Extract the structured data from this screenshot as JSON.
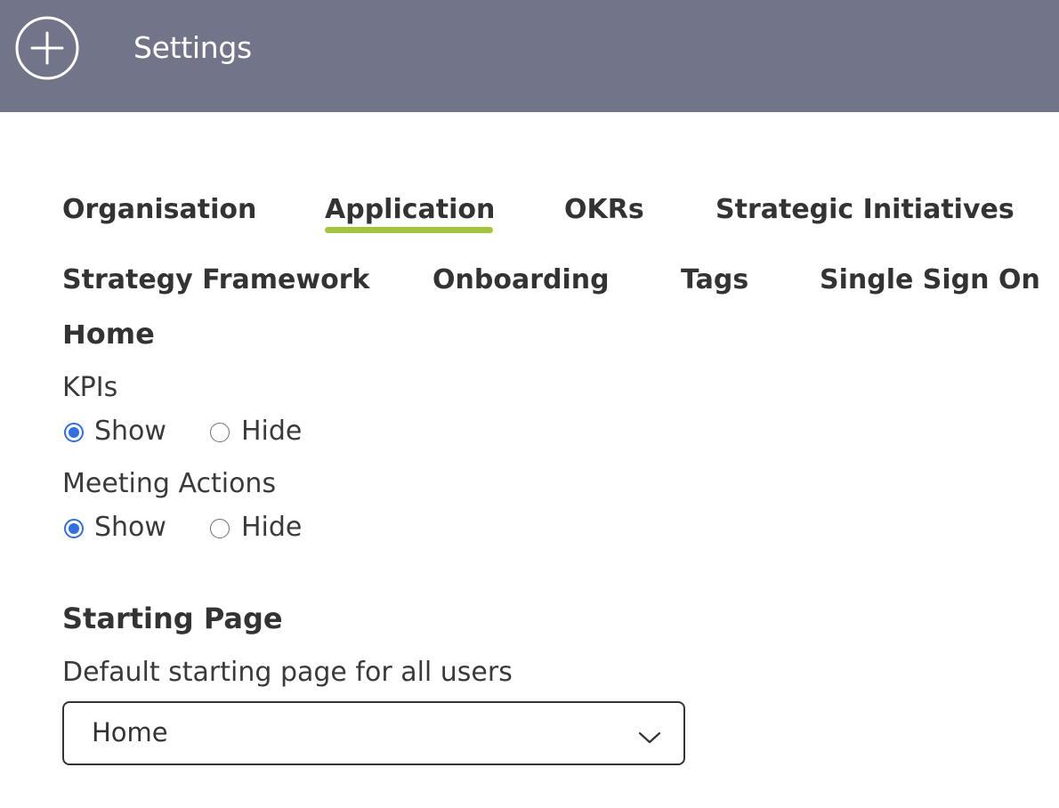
{
  "header": {
    "title": "Settings",
    "add_icon": "plus-circle-icon",
    "background": "#727489"
  },
  "tabs": [
    {
      "label": "Organisation",
      "active": false
    },
    {
      "label": "Application",
      "active": true
    },
    {
      "label": "OKRs",
      "active": false
    },
    {
      "label": "Strategic Initiatives",
      "active": false
    },
    {
      "label": "Strategy Framework",
      "active": false
    },
    {
      "label": "Onboarding",
      "active": false
    },
    {
      "label": "Tags",
      "active": false
    },
    {
      "label": "Single Sign On",
      "active": false
    }
  ],
  "accent_color": "#a5c43e",
  "home_section": {
    "title": "Home",
    "kpis": {
      "label": "KPIs",
      "options": [
        "Show",
        "Hide"
      ],
      "selected": "Show"
    },
    "meeting_actions": {
      "label": "Meeting Actions",
      "options": [
        "Show",
        "Hide"
      ],
      "selected": "Show"
    }
  },
  "starting_page": {
    "title": "Starting Page",
    "label": "Default starting page for all users",
    "selected_value": "Home",
    "dropdown_icon": "chevron-down-icon"
  },
  "radio_color": "#2f6fe0"
}
